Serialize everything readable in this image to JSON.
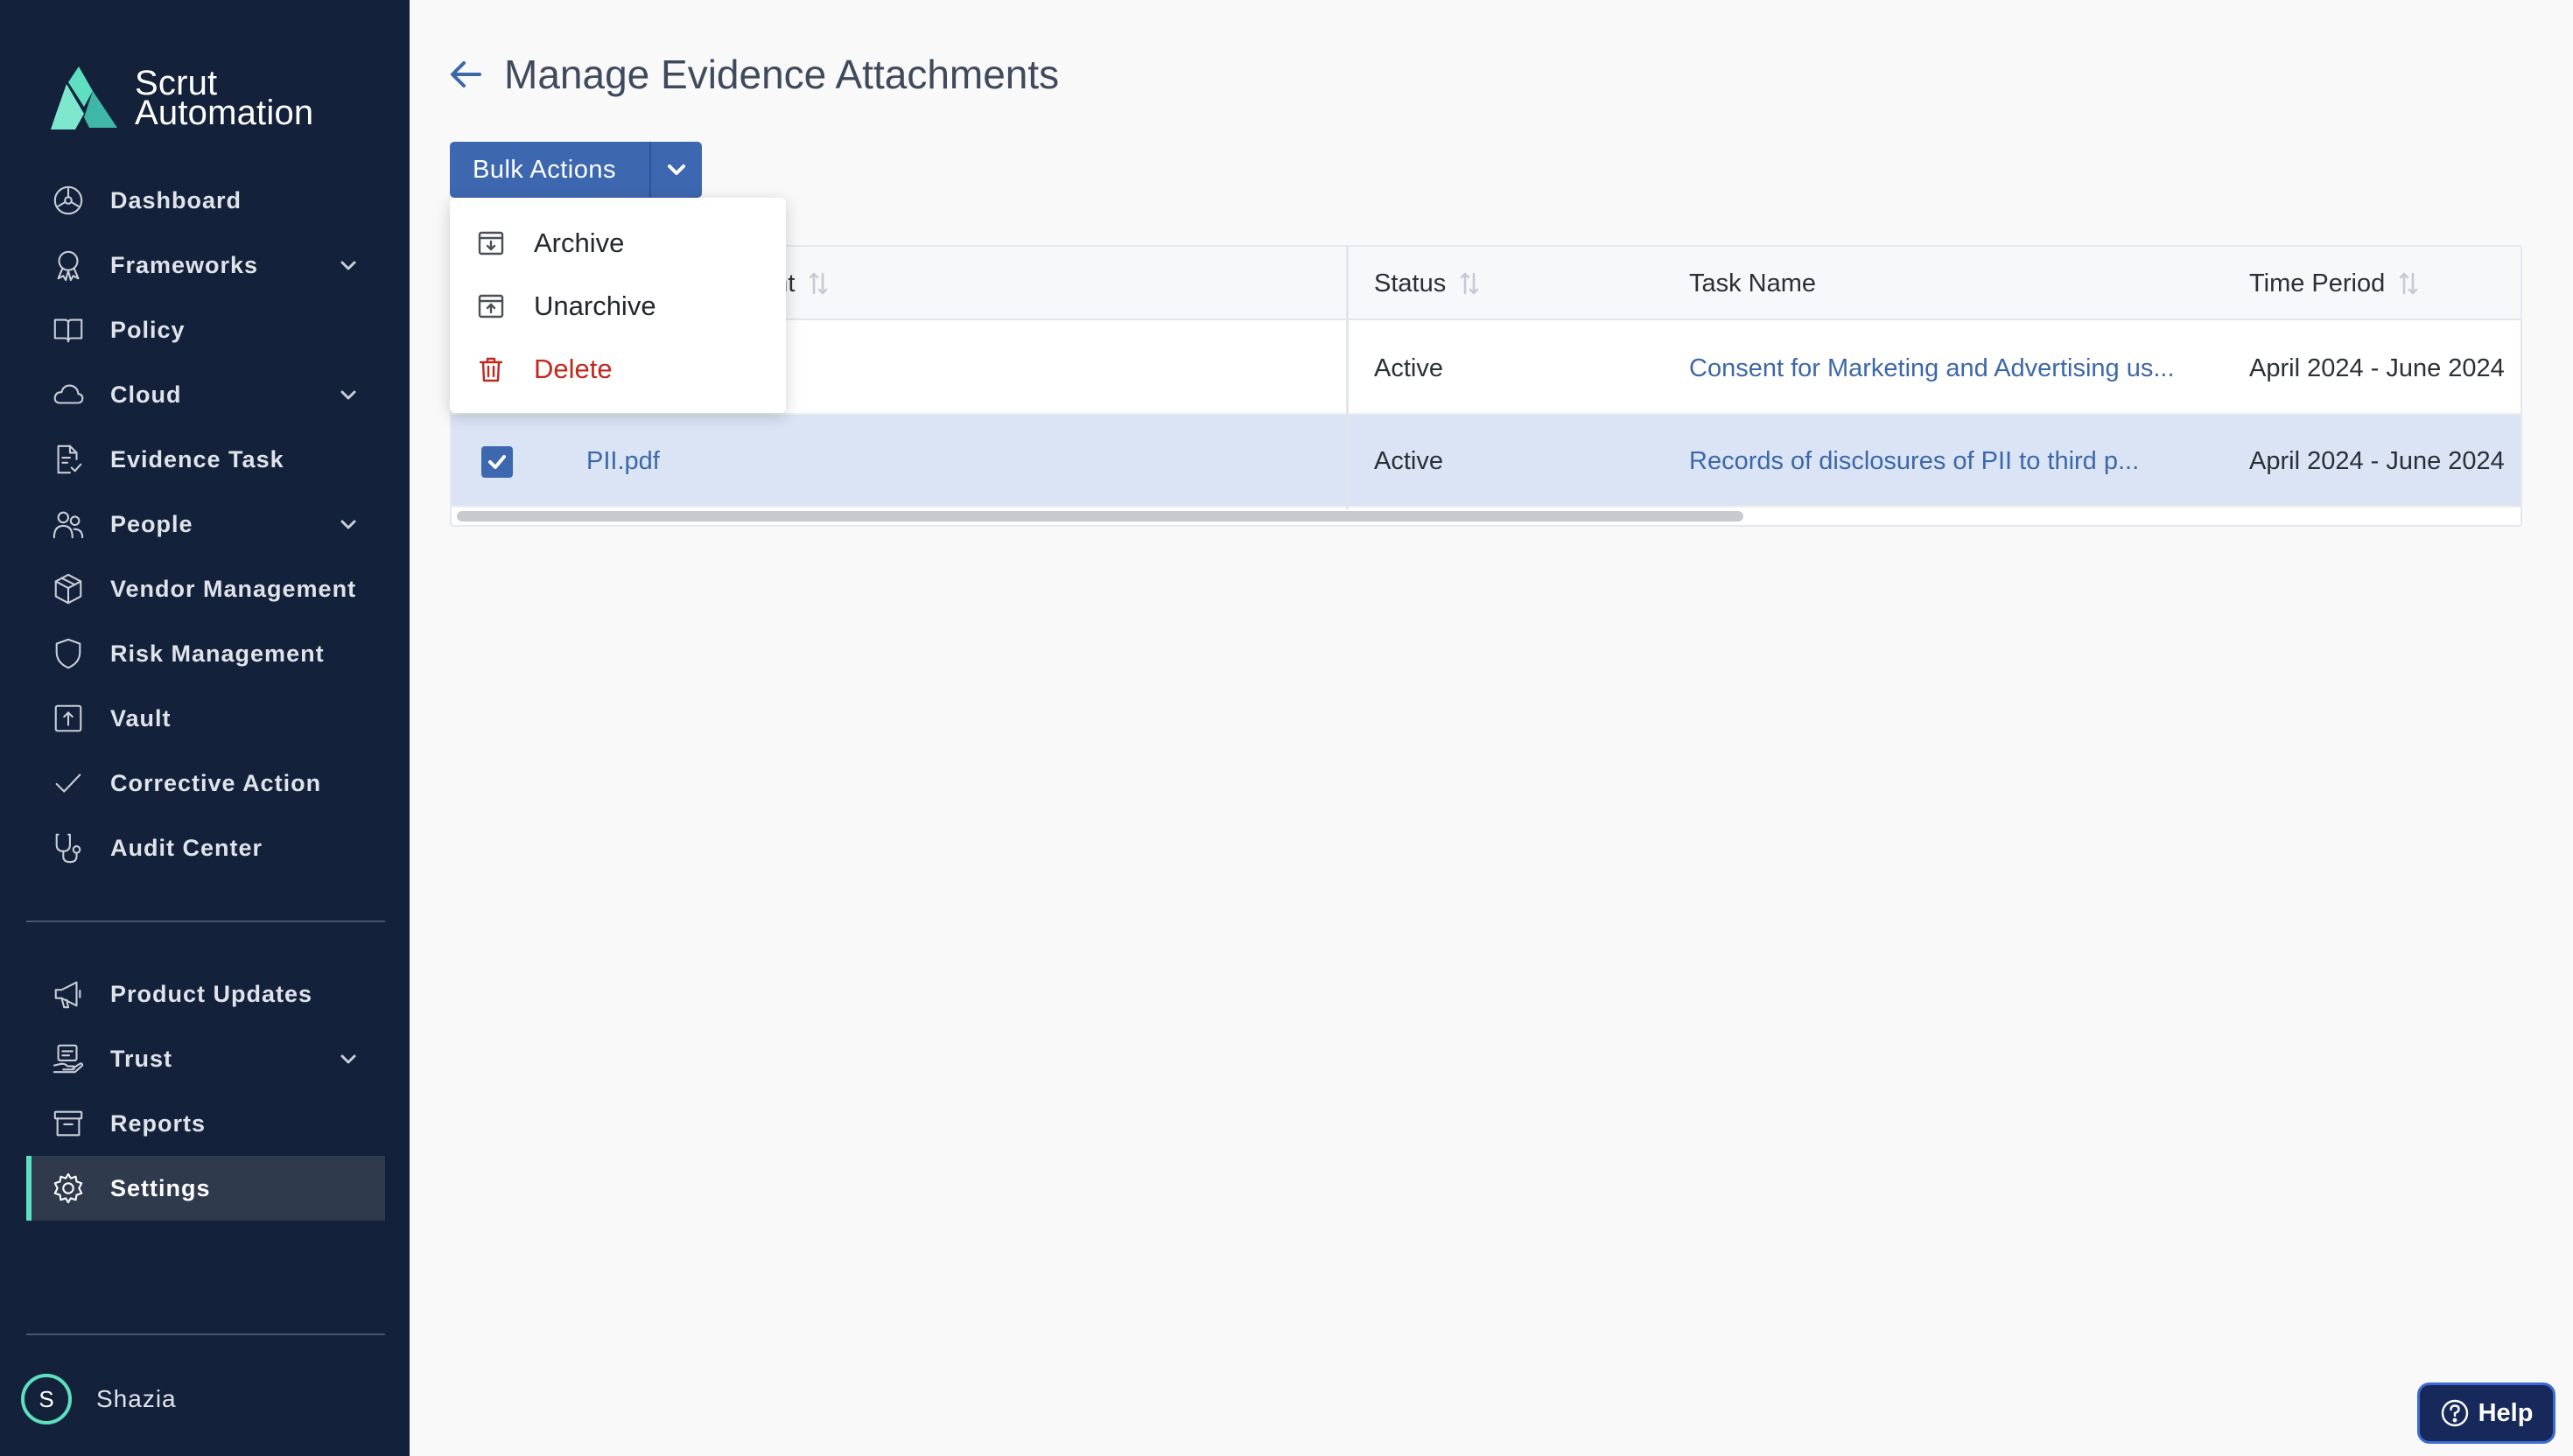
{
  "app": {
    "logo_line1": "Scrut",
    "logo_line2": "Automation",
    "brand_accent": "#5ee0c0",
    "sidebar_bg": "#14213a",
    "primary": "#3d68b0"
  },
  "sidebar": {
    "items": [
      {
        "label": "Dashboard",
        "icon": "dashboard-icon"
      },
      {
        "label": "Frameworks",
        "icon": "award-icon",
        "expandable": true
      },
      {
        "label": "Policy",
        "icon": "book-icon"
      },
      {
        "label": "Cloud",
        "icon": "cloud-icon",
        "expandable": true
      },
      {
        "label": "Evidence Task",
        "icon": "file-check-icon"
      },
      {
        "label": "People",
        "icon": "people-icon",
        "expandable": true
      },
      {
        "label": "Vendor Management",
        "icon": "box-icon"
      },
      {
        "label": "Risk Management",
        "icon": "shield-icon"
      },
      {
        "label": "Vault",
        "icon": "vault-icon"
      },
      {
        "label": "Corrective Action",
        "icon": "check-icon"
      },
      {
        "label": "Audit Center",
        "icon": "stethoscope-icon"
      }
    ],
    "bottom_items": [
      {
        "label": "Product Updates",
        "icon": "megaphone-icon"
      },
      {
        "label": "Trust",
        "icon": "trust-icon",
        "expandable": true
      },
      {
        "label": "Reports",
        "icon": "archive-icon"
      },
      {
        "label": "Settings",
        "icon": "gear-icon",
        "active": true
      }
    ],
    "user": {
      "initial": "S",
      "name": "Shazia"
    }
  },
  "header": {
    "title": "Manage Evidence Attachments"
  },
  "toolbar": {
    "bulk_actions_label": "Bulk Actions"
  },
  "bulk_menu": {
    "items": [
      {
        "label": "Archive",
        "icon": "archive-box-down-icon"
      },
      {
        "label": "Unarchive",
        "icon": "archive-box-up-icon"
      },
      {
        "label": "Delete",
        "icon": "trash-icon",
        "color": "#c0281f"
      }
    ]
  },
  "table": {
    "columns": {
      "attachment": "ment",
      "status": "Status",
      "task_name": "Task Name",
      "time_period": "Time Period"
    },
    "rows": [
      {
        "attachment": "",
        "status": "Active",
        "task_name": "Consent for Marketing and Advertising us...",
        "time_period": "April 2024 - June 2024",
        "selected": false
      },
      {
        "attachment": "PII.pdf",
        "status": "Active",
        "task_name": "Records of disclosures of PII to third p...",
        "time_period": "April 2024 - June 2024",
        "selected": true
      }
    ]
  },
  "help": {
    "label": "Help"
  }
}
